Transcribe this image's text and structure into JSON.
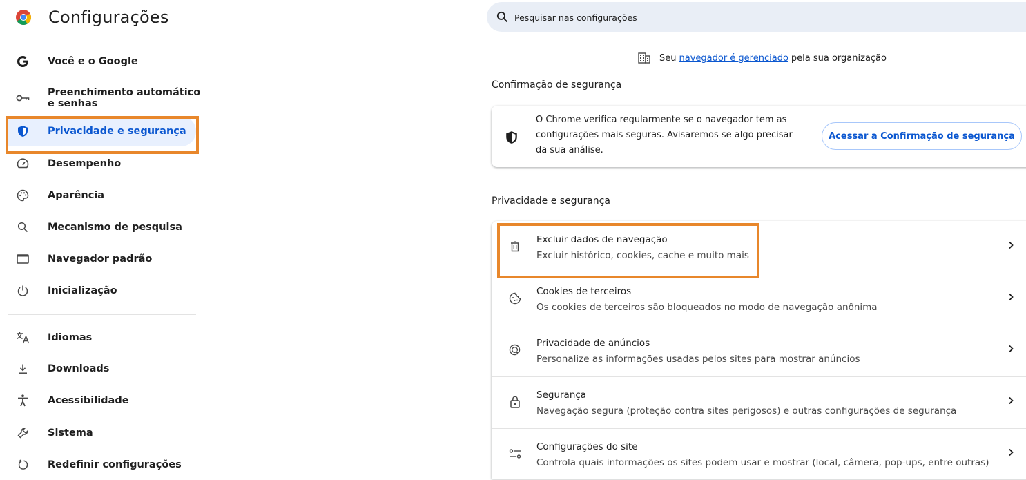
{
  "app": {
    "title": "Configurações",
    "logo_icon": "chrome-logo-icon"
  },
  "sidebar": {
    "items": [
      {
        "label": "Você e o Google",
        "icon": "google-g-icon"
      },
      {
        "label": "Preenchimento automático e senhas",
        "icon": "key-icon"
      },
      {
        "label": "Privacidade e segurança",
        "icon": "shield-icon",
        "active": true
      },
      {
        "label": "Desempenho",
        "icon": "speedometer-icon"
      },
      {
        "label": "Aparência",
        "icon": "palette-icon"
      },
      {
        "label": "Mecanismo de pesquisa",
        "icon": "search-icon"
      },
      {
        "label": "Navegador padrão",
        "icon": "browser-window-icon"
      },
      {
        "label": "Inicialização",
        "icon": "power-icon"
      },
      {
        "label": "Idiomas",
        "icon": "translate-icon"
      },
      {
        "label": "Downloads",
        "icon": "download-icon"
      },
      {
        "label": "Acessibilidade",
        "icon": "accessibility-icon"
      },
      {
        "label": "Sistema",
        "icon": "wrench-icon"
      },
      {
        "label": "Redefinir configurações",
        "icon": "reset-icon"
      }
    ]
  },
  "search": {
    "placeholder": "Pesquisar nas configurações"
  },
  "managed_notice": {
    "prefix": "Seu",
    "link": "navegador é gerenciado",
    "suffix": "pela sua organização",
    "icon": "building-icon"
  },
  "safety_check": {
    "section_title": "Confirmação de segurança",
    "description": "O Chrome verifica regularmente se o navegador tem as configurações mais seguras. Avisaremos se algo precisar da sua análise.",
    "button_label": "Acessar a Confirmação de segurança",
    "icon": "shield-icon"
  },
  "privacy": {
    "section_title": "Privacidade e segurança",
    "rows": [
      {
        "title": "Excluir dados de navegação",
        "subtitle": "Excluir histórico, cookies, cache e muito mais",
        "icon": "trash-icon"
      },
      {
        "title": "Cookies de terceiros",
        "subtitle": "Os cookies de terceiros são bloqueados no modo de navegação anônima",
        "icon": "cookie-icon"
      },
      {
        "title": "Privacidade de anúncios",
        "subtitle": "Personalize as informações usadas pelos sites para mostrar anúncios",
        "icon": "ad-privacy-icon"
      },
      {
        "title": "Segurança",
        "subtitle": "Navegação segura (proteção contra sites perigosos) e outras configurações de segurança",
        "icon": "lock-icon"
      },
      {
        "title": "Configurações do site",
        "subtitle": "Controla quais informações os sites podem usar e mostrar (local, câmera, pop-ups, entre outras)",
        "icon": "tune-icon"
      }
    ]
  },
  "colors": {
    "accent": "#0b57d0",
    "active_bg": "#e8f0fe",
    "highlight": "#e8872b"
  }
}
